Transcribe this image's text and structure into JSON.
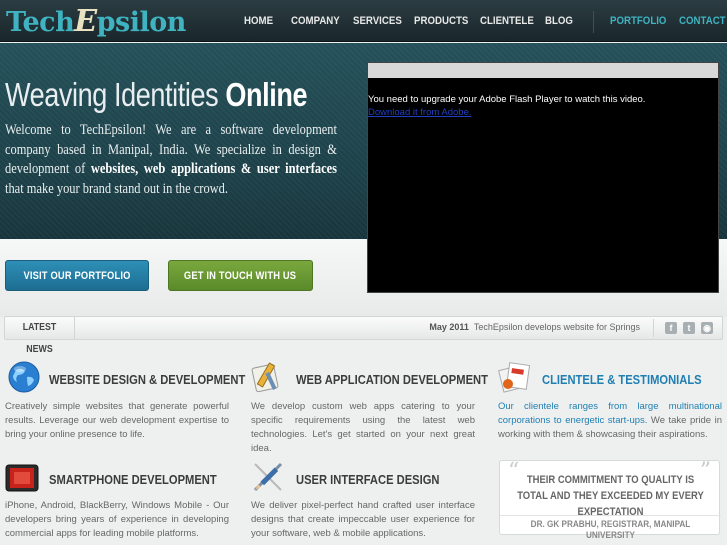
{
  "brand": {
    "logo_prefix": "Tech",
    "logo_e": "E",
    "logo_suffix": "psilon"
  },
  "nav": {
    "items": [
      "HOME",
      "COMPANY",
      "SERVICES",
      "PRODUCTS",
      "CLIENTELE",
      "BLOG"
    ],
    "accent_items": [
      "PORTFOLIO",
      "CONTACT US"
    ]
  },
  "hero": {
    "title_plain": "Weaving Identities ",
    "title_bold": "Online",
    "intro_1": "Welcome to TechEpsilon! We are a software development company based in Manipal, India. We specialize in design & development of ",
    "intro_bold": "websites, web applications & user interfaces",
    "intro_2": " that make your brand stand out in the crowd.",
    "button_portfolio": "VISIT OUR PORTFOLIO",
    "button_touch": "GET IN TOUCH WITH US"
  },
  "video": {
    "message": "You need to upgrade your Adobe Flash Player to watch this video.",
    "link": "Download it from Adobe."
  },
  "news": {
    "label": "LATEST NEWS",
    "date": "May 2011",
    "headline": "TechEpsilon develops website for Springs"
  },
  "social": [
    "f",
    "t",
    "rss"
  ],
  "features": [
    {
      "title": "WEBSITE DESIGN & DEVELOPMENT",
      "text": "Creatively simple websites that generate powerful results. Leverage our web development expertise to bring your online presence to life.",
      "icon": "globe-icon"
    },
    {
      "title": "WEB APPLICATION DEVELOPMENT",
      "text": "We develop custom web apps catering to your specific requirements using the latest web technologies. Let's get started on your next great idea.",
      "icon": "tools-icon"
    },
    {
      "title": "CLIENTELE & TESTIMONIALS",
      "text_blue": "Our clientele ranges from large multinational corporations to energetic start-ups.",
      "text": " We take pride in working with them & showcasing their aspirations.",
      "icon": "documents-icon"
    },
    {
      "title": "SMARTPHONE DEVELOPMENT",
      "text": "iPhone, Android, BlackBerry, Windows Mobile - Our developers bring years of experience in developing commercial apps for leading mobile platforms.",
      "icon": "phone-icon"
    },
    {
      "title": "USER INTERFACE DESIGN",
      "text": "We deliver pixel-perfect hand crafted user interface designs that create impeccable user experience for your software, web & mobile applications.",
      "icon": "pencil-ruler-icon"
    }
  ],
  "testimonial": {
    "quote": "THEIR COMMITMENT TO QUALITY IS TOTAL AND THEY EXCEEDED MY EVERY EXPECTATION",
    "author": "DR. GK PRABHU, REGISTRAR, MANIPAL UNIVERSITY"
  },
  "colors": {
    "header": "#1f2e33",
    "hero": "#214a53",
    "accent": "#3fb3c2",
    "blue_button": "#2585ad",
    "green_button": "#6b9a35"
  }
}
